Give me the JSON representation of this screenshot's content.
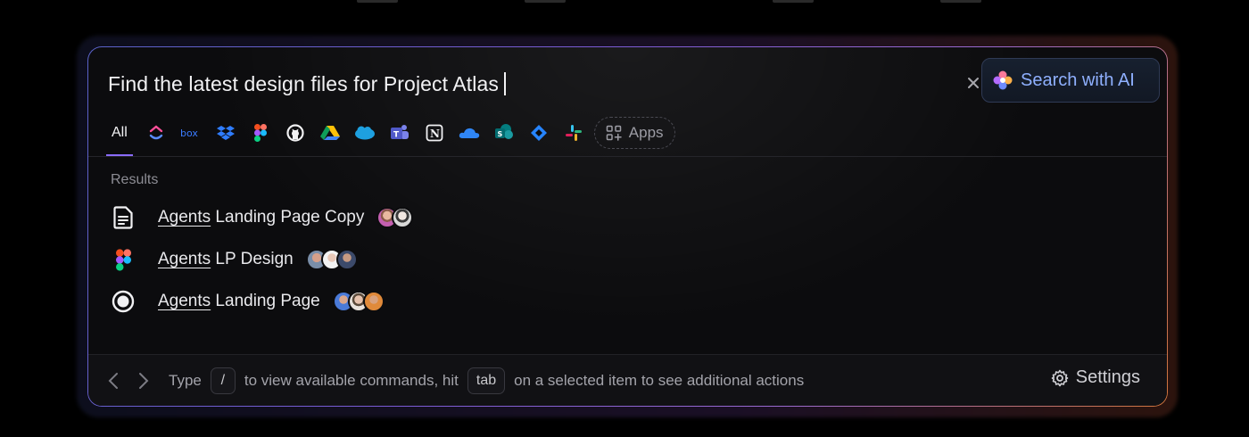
{
  "search": {
    "query": "Find the latest design files for Project Atlas",
    "clear_label": "×",
    "ai_button_label": "Search with AI"
  },
  "filters": {
    "all_label": "All",
    "sources": [
      "clickup-icon",
      "box-icon",
      "dropbox-icon",
      "figma-icon",
      "github-icon",
      "google-drive-icon",
      "salesforce-icon",
      "teams-icon",
      "notion-icon",
      "onedrive-icon",
      "sharepoint-icon",
      "jira-icon",
      "slack-icon"
    ],
    "apps_label": "Apps"
  },
  "results": {
    "label": "Results",
    "items": [
      {
        "highlight": "Agents",
        "rest": " Landing Page Copy",
        "icon": "document-icon"
      },
      {
        "highlight": "Agents",
        "rest": " LP Design",
        "icon": "figma-icon"
      },
      {
        "highlight": "Agents",
        "rest": " Landing Page",
        "icon": "record-icon"
      }
    ]
  },
  "footer": {
    "type_label": "Type",
    "slash_key": "/",
    "mid_text": "to view available commands, hit",
    "tab_key": "tab",
    "end_text": "on a selected item to see additional actions",
    "settings_label": "Settings"
  },
  "colors": {
    "accent": "#8a6cff",
    "ai_text": "#8fb0ff",
    "border_start": "#5a63c9",
    "border_end": "#d0743c"
  }
}
